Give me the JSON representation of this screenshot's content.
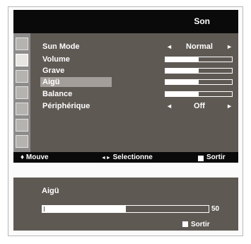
{
  "menu": {
    "title": "Son",
    "rows": [
      {
        "label": "Sun Mode",
        "type": "select",
        "value": "Normal"
      },
      {
        "label": "Volume",
        "type": "bar",
        "level_percent": 50
      },
      {
        "label": "Grave",
        "type": "bar",
        "level_percent": 50
      },
      {
        "label": "Aigü",
        "type": "bar",
        "level_percent": 50,
        "selected": true
      },
      {
        "label": "Balance",
        "type": "bar",
        "level_percent": 50
      },
      {
        "label": "Périphérique",
        "type": "select",
        "value": "Off"
      }
    ],
    "arrow_left": "◄",
    "arrow_right": "►",
    "footer": {
      "move_icon": "♦",
      "move": "Mouve",
      "select_icon": "◄►",
      "select": "Selectionne",
      "exit": "Sortir"
    }
  },
  "panel": {
    "title": "Aigü",
    "level_percent": 50,
    "value": "50",
    "exit": "Sortir"
  },
  "colors": {
    "menu_bg": "#5f5954",
    "bar_bg": "#0a0a0a",
    "highlight": "#a39e99"
  }
}
